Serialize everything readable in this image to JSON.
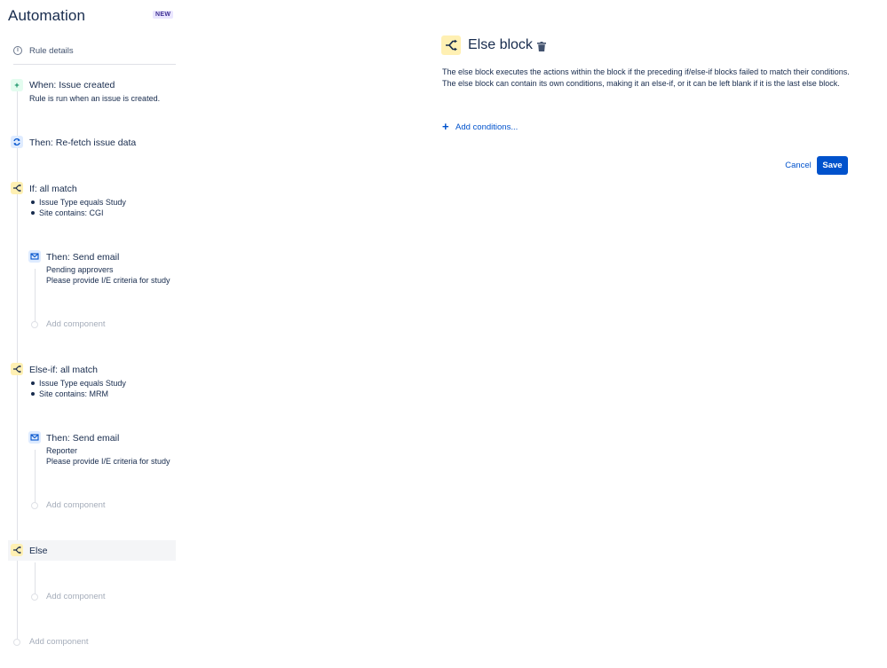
{
  "header": {
    "title": "Automation",
    "badge": "NEW"
  },
  "rule_details": {
    "label": "Rule details",
    "icon": "info-icon"
  },
  "steps": {
    "trigger": {
      "title": "When: Issue created",
      "subtitle": "Rule is run when an issue is created.",
      "icon": "plus-icon"
    },
    "refetch": {
      "title": "Then: Re-fetch issue data",
      "icon": "refresh-icon"
    },
    "if_block": {
      "title": "If: all match",
      "conditions": [
        "Issue Type equals Study",
        "Site contains: CGI"
      ],
      "icon": "branch-icon",
      "action": {
        "title": "Then: Send email",
        "line1": "Pending approvers",
        "line2": "Please provide I/E criteria for study",
        "icon": "mail-icon"
      },
      "add_component": "Add component"
    },
    "else_if_block": {
      "title": "Else-if: all match",
      "conditions": [
        "Issue Type equals Study",
        "Site contains: MRM"
      ],
      "icon": "branch-icon",
      "action": {
        "title": "Then: Send email",
        "line1": "Reporter",
        "line2": "Please provide I/E criteria for study",
        "icon": "mail-icon"
      },
      "add_component": "Add component"
    },
    "else_block": {
      "title": "Else",
      "icon": "branch-icon",
      "add_component": "Add component"
    },
    "add_component": "Add component"
  },
  "panel": {
    "title": "Else block",
    "description": "The else block executes the actions within the block if the preceding if/else-if blocks failed to match their conditions. The else block can contain its own conditions, making it an else-if, or it can be left blank if it is the last else block.",
    "add_conditions": "Add conditions...",
    "cancel": "Cancel",
    "save": "Save"
  },
  "colors": {
    "accent": "#0052cc",
    "branch_bg": "#fff0b3",
    "trigger_bg": "#e3fcef",
    "action_bg": "#deebff",
    "badge_bg": "#eae6ff"
  }
}
